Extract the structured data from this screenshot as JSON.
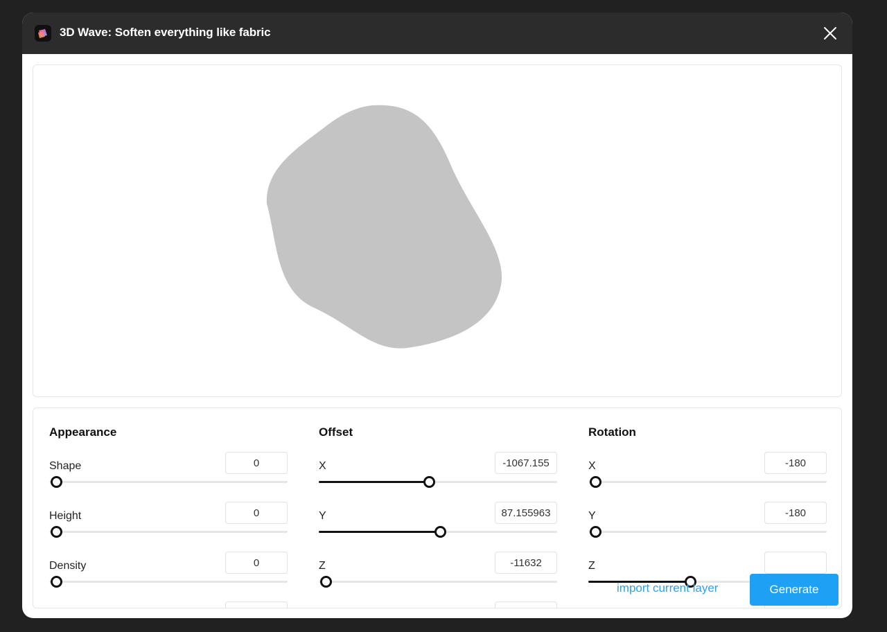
{
  "window": {
    "title": "3D Wave: Soften everything like fabric",
    "app_icon": "gradient-app-icon",
    "close_icon": "close-icon"
  },
  "colors": {
    "titlebar": "#2c2c2c",
    "backdrop": "#212121",
    "blob": "#c4c4c4",
    "accent": "#1ea1f5",
    "link": "#2aa2f2"
  },
  "preview": {
    "shape": "gray-blob"
  },
  "groups": [
    {
      "title": "Appearance",
      "rows": [
        {
          "label": "Shape",
          "value": "0",
          "fraction": 0
        },
        {
          "label": "Height",
          "value": "0",
          "fraction": 0
        },
        {
          "label": "Density",
          "value": "0",
          "fraction": 0
        }
      ]
    },
    {
      "title": "Offset",
      "rows": [
        {
          "label": "X",
          "value": "-1067.155",
          "fraction": 0.455
        },
        {
          "label": "Y",
          "value": "87.155963",
          "fraction": 0.505
        },
        {
          "label": "Z",
          "value": "-11632",
          "fraction": 0
        }
      ]
    },
    {
      "title": "Rotation",
      "rows": [
        {
          "label": "X",
          "value": "-180",
          "fraction": 0
        },
        {
          "label": "Y",
          "value": "-180",
          "fraction": 0
        },
        {
          "label": "Z",
          "value": "",
          "fraction": 0.42
        }
      ]
    }
  ],
  "actions": {
    "import_label": "import current layer",
    "generate_label": "Generate"
  }
}
